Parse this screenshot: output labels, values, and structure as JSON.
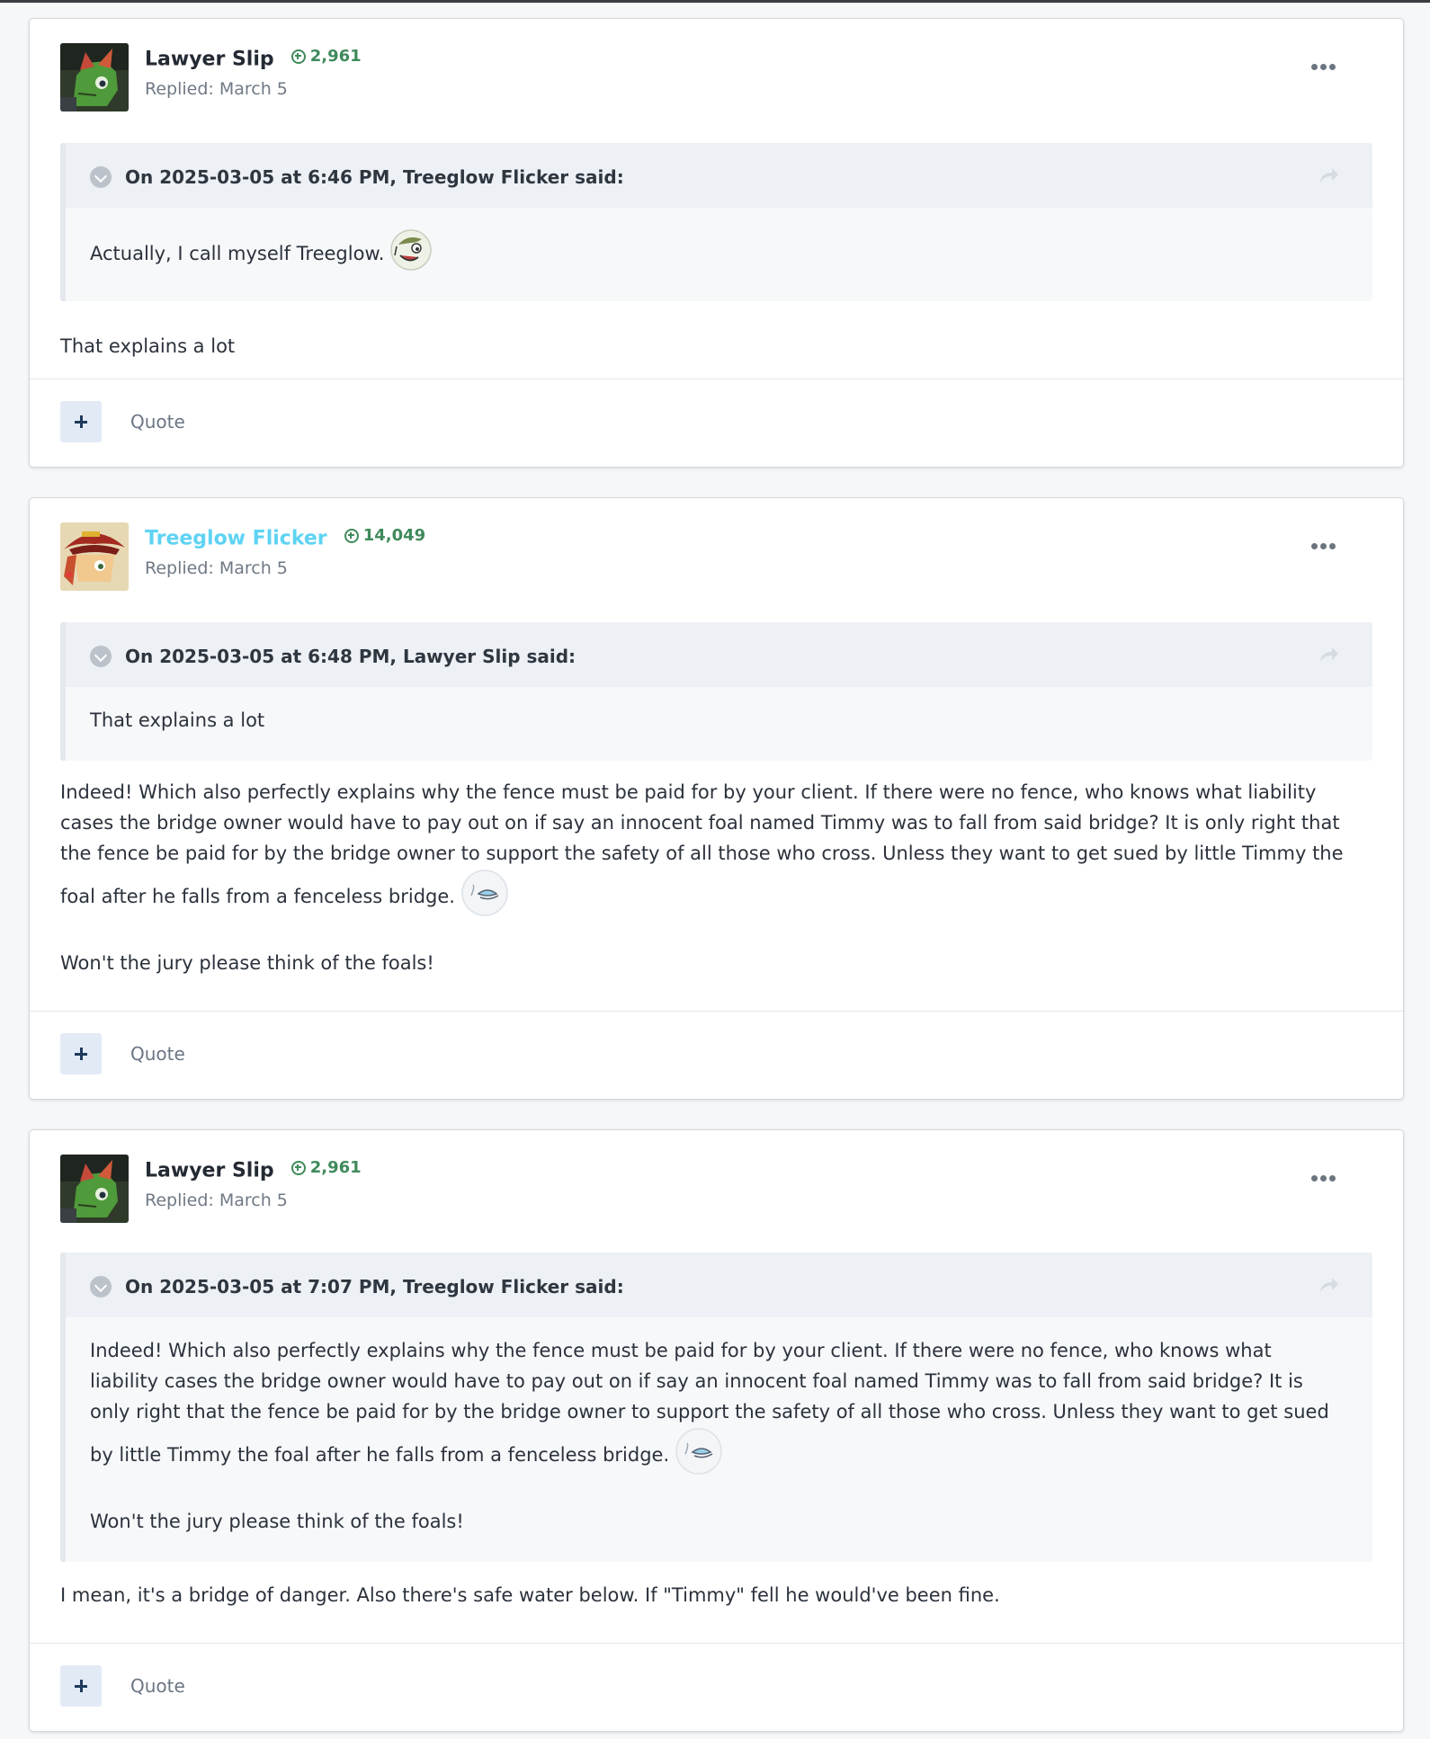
{
  "colors": {
    "reputation": "#3f8a5b",
    "alt_username": "#5ed3f3",
    "quote_bg": "#f6f8fa",
    "quote_cite_bg": "#edf0f4",
    "plus_button_bg": "#e2ebf5"
  },
  "icons": {
    "reputation": "plus-circle-icon",
    "more": "ellipsis-icon",
    "toggle": "chevron-down-circle-icon",
    "share": "share-arrow-icon",
    "react": "plus-icon"
  },
  "posts": [
    {
      "author": "Lawyer Slip",
      "reputation": "2,961",
      "replied": "Replied: March 5",
      "quote": {
        "cite": "On 2025-03-05 at 6:46 PM, Treeglow Flicker said:",
        "body": [
          "Actually, I call myself Treeglow."
        ],
        "emoji": "grinning-pony-emoji"
      },
      "content": [
        "That explains a lot"
      ],
      "quote_label": "Quote"
    },
    {
      "author": "Treeglow Flicker",
      "reputation": "14,049",
      "replied": "Replied: March 5",
      "quote": {
        "cite": "On 2025-03-05 at 6:48 PM, Lawyer Slip said:",
        "body": [
          "That explains a lot"
        ]
      },
      "content": [
        "Indeed! Which also perfectly explains why the fence must be paid for by your client. If there were no fence, who knows what liability cases the bridge owner would have to pay out on if say an innocent foal named Timmy was to fall from said bridge? It is only right that the fence be paid for by the bridge owner to support the safety of all those who cross. Unless they want to get sued by little Timmy the foal after he falls from a fenceless bridge.",
        "Won't the jury please think of the foals!"
      ],
      "content_emoji": "sleepy-emoji",
      "quote_label": "Quote"
    },
    {
      "author": "Lawyer Slip",
      "reputation": "2,961",
      "replied": "Replied: March 5",
      "quote": {
        "cite": "On 2025-03-05 at 7:07 PM, Treeglow Flicker said:",
        "body": [
          "Indeed! Which also perfectly explains why the fence must be paid for by your client. If there were no fence, who knows what liability cases the bridge owner would have to pay out on if say an innocent foal named Timmy was to fall from said bridge? It is only right that the fence be paid for by the bridge owner to support the safety of all those who cross. Unless they want to get sued by little Timmy the foal after he falls from a fenceless bridge.",
          "Won't the jury please think of the foals!"
        ],
        "emoji": "sleepy-emoji"
      },
      "content": [
        "I mean, it's a bridge of danger. Also there's safe water below. If \"Timmy\" fell he would've been fine."
      ],
      "quote_label": "Quote"
    }
  ]
}
